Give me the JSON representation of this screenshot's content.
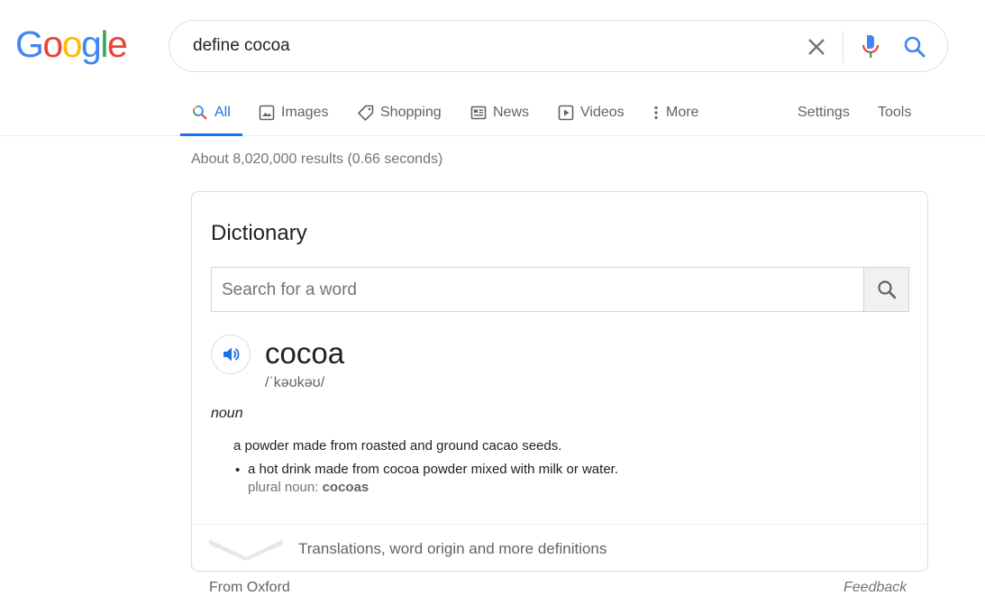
{
  "logo": {
    "letters": [
      "G",
      "o",
      "o",
      "g",
      "l",
      "e"
    ]
  },
  "search": {
    "query": "define cocoa"
  },
  "tabs": [
    {
      "label": "All",
      "icon": "search-icon"
    },
    {
      "label": "Images",
      "icon": "image-icon"
    },
    {
      "label": "Shopping",
      "icon": "tag-icon"
    },
    {
      "label": "News",
      "icon": "news-icon"
    },
    {
      "label": "Videos",
      "icon": "video-icon"
    },
    {
      "label": "More",
      "icon": "more-vert-icon"
    }
  ],
  "tools": {
    "settings": "Settings",
    "tools": "Tools"
  },
  "stats": "About 8,020,000 results (0.66 seconds)",
  "dictionary": {
    "title": "Dictionary",
    "search_placeholder": "Search for a word",
    "word": "cocoa",
    "phonetic": "/ˈkəʊkəʊ/",
    "part_of_speech": "noun",
    "definition_1": "a powder made from roasted and ground cacao seeds.",
    "bullet": "•",
    "definition_2": "a hot drink made from cocoa powder mixed with milk or water.",
    "plural_label": "plural noun:",
    "plural_value": "cocoas",
    "more_label": "Translations, word origin and more definitions"
  },
  "footer": {
    "source": "From Oxford",
    "feedback": "Feedback"
  },
  "colors": {
    "accent": "#1a73e8",
    "text": "#202124",
    "muted": "#70757a"
  }
}
